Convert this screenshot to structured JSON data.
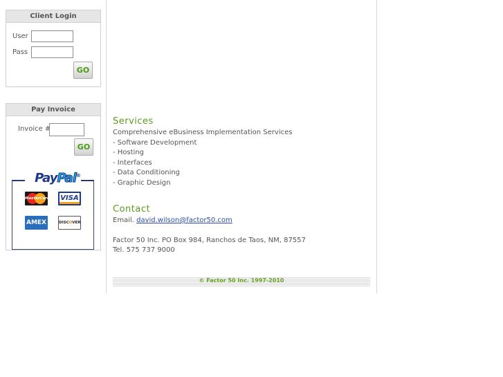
{
  "login": {
    "title": "Client Login",
    "user_label": "User",
    "user_value": "",
    "pass_label": "Pass",
    "pass_value": "",
    "go_label": "GO"
  },
  "invoice": {
    "title": "Pay Invoice",
    "invoice_label": "Invoice #",
    "invoice_value": "",
    "go_label": "GO"
  },
  "payment": {
    "brand_a": "Pay",
    "brand_b": "Pal",
    "brand_mark": "®",
    "cards": {
      "mastercard": "MasterCard",
      "visa": "VISA",
      "amex": "AMEX",
      "discover_a": "DISC",
      "discover_b": "O",
      "discover_c": "VER"
    }
  },
  "services": {
    "heading": "Services",
    "intro": "Comprehensive eBusiness Implementation Services",
    "items": [
      "- Software Development",
      "- Hosting",
      "- Interfaces",
      "- Data Conditioning",
      "- Graphic Design"
    ]
  },
  "contact": {
    "heading": "Contact",
    "email_label": "Email. ",
    "email": "david.wilson@factor50.com",
    "address": "Factor 50 Inc. PO Box 984, Ranchos de Taos, NM, 87557",
    "phone": "Tel. 575 737 9000"
  },
  "footer": {
    "copyright": "© Factor 50 Inc. 1997-2010"
  }
}
